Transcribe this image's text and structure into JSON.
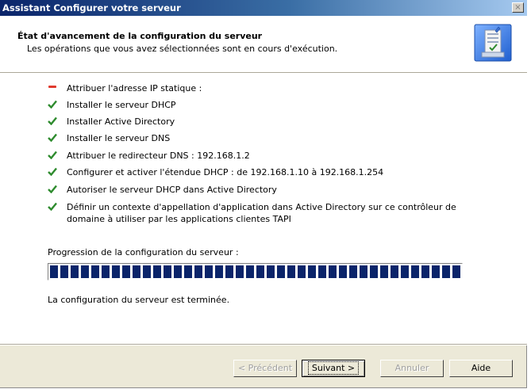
{
  "window": {
    "title": "Assistant Configurer votre serveur",
    "close_symbol": "×"
  },
  "header": {
    "title": "État d'avancement de la configuration du serveur",
    "subtitle": "Les opérations que vous avez sélectionnées sont en cours d'exécution.",
    "icon": "server-wizard-icon"
  },
  "tasks": [
    {
      "status": "in-progress",
      "label": "Attribuer l'adresse IP statique :"
    },
    {
      "status": "done",
      "label": "Installer le serveur DHCP"
    },
    {
      "status": "done",
      "label": "Installer Active Directory"
    },
    {
      "status": "done",
      "label": "Installer le serveur DNS"
    },
    {
      "status": "done",
      "label": "Attribuer le redirecteur DNS : 192.168.1.2"
    },
    {
      "status": "done",
      "label": "Configurer et activer l'étendue DHCP : de 192.168.1.10 à 192.168.1.254"
    },
    {
      "status": "done",
      "label": "Autoriser le serveur DHCP dans Active Directory"
    },
    {
      "status": "done",
      "label": "Définir un contexte d'appellation d'application dans Active Directory sur ce contrôleur de domaine à utiliser par les applications clientes TAPI"
    }
  ],
  "progress": {
    "label": "Progression de la configuration du serveur :",
    "percent": 100,
    "status_text": "La configuration du serveur est terminée."
  },
  "buttons": {
    "back": "< Précédent",
    "next": "Suivant >",
    "cancel": "Annuler",
    "help": "Aide"
  },
  "colors": {
    "titlebar": "#0a246a",
    "check": "#2e8b2e",
    "in_progress": "#e03a2e",
    "progress_block": "#0a246a"
  }
}
